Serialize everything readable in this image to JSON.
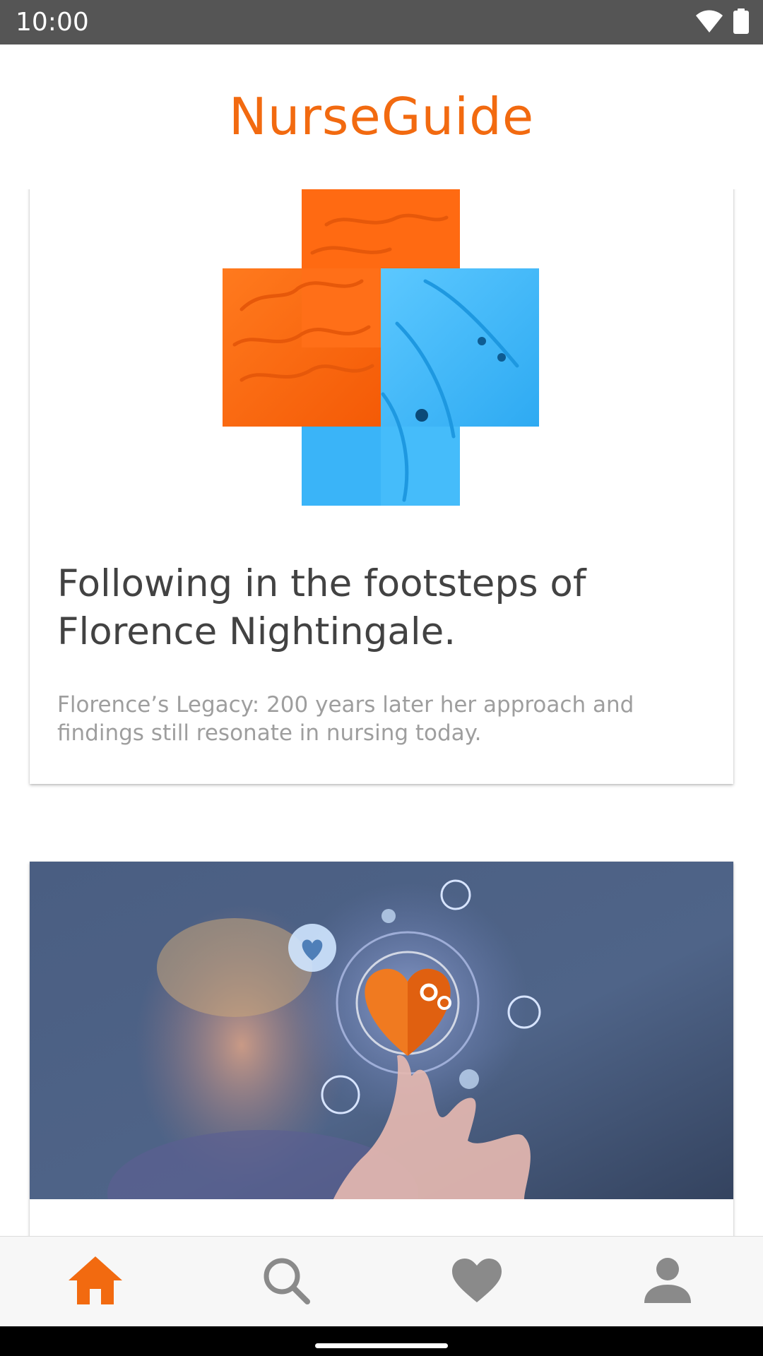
{
  "status_bar": {
    "time": "10:00",
    "icons": [
      "wifi-icon",
      "battery-icon"
    ]
  },
  "header": {
    "title": "NurseGuide"
  },
  "feed": {
    "cards": [
      {
        "image": "brain-heart-cross-illustration",
        "title": "Following in the footsteps of Florence Nightingale.",
        "subtitle": "Florence’s Legacy: 200 years later her approach and findings still resonate in nursing today."
      },
      {
        "image": "nurse-touching-heart-hologram-photo"
      }
    ]
  },
  "bottom_nav": {
    "items": [
      {
        "icon": "home-icon",
        "active": true
      },
      {
        "icon": "search-icon",
        "active": false
      },
      {
        "icon": "heart-icon",
        "active": false
      },
      {
        "icon": "person-icon",
        "active": false
      }
    ]
  },
  "colors": {
    "brand": "#f26a10",
    "inactive_icon": "#8a8a8a",
    "status_bar": "#555555",
    "title_text": "#424242",
    "subtitle_text": "#9e9e9e"
  }
}
